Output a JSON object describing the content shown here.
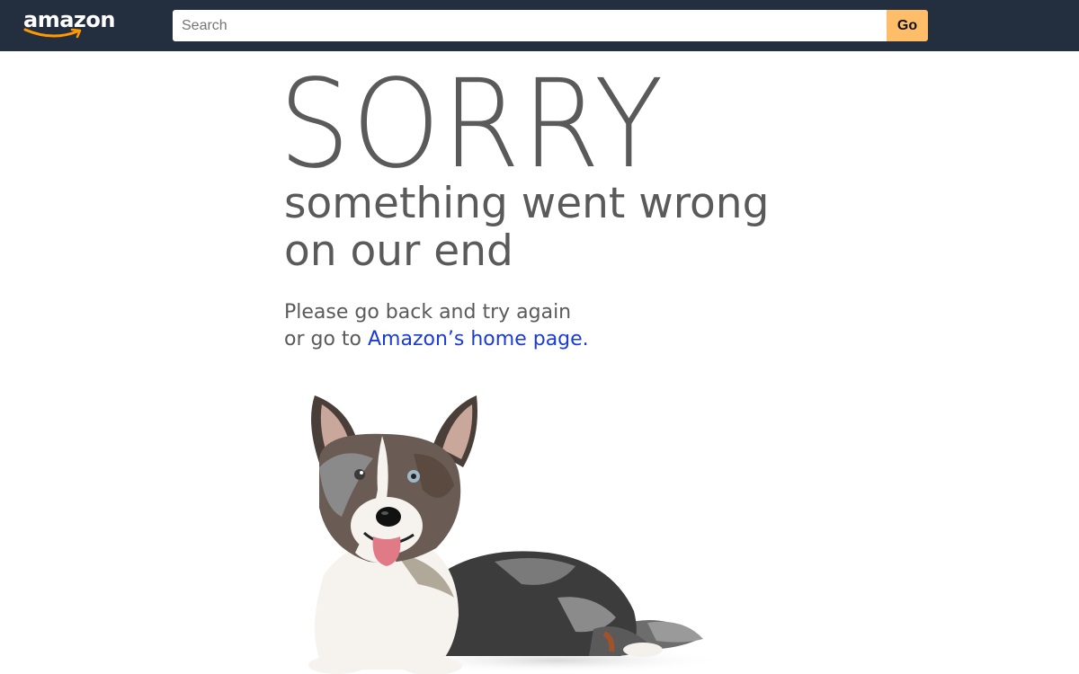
{
  "header": {
    "logo_text": "amazon",
    "logo_icon": "amazon-smile-logo",
    "search": {
      "placeholder": "Search",
      "value": ""
    },
    "go_label": "Go",
    "colors": {
      "bar": "#232f3e",
      "go_button": "#febd69"
    }
  },
  "main": {
    "headline": "SORRY",
    "subtitle_line1": "something went wrong",
    "subtitle_line2": "on our end",
    "message_line1": "Please go back and try again",
    "message_line2_prefix": "or go to ",
    "home_link": "Amazon’s home page.",
    "colors": {
      "text": "#5a5a5a",
      "link": "#1a3bd6"
    },
    "image": "corgi-dog-photo"
  }
}
